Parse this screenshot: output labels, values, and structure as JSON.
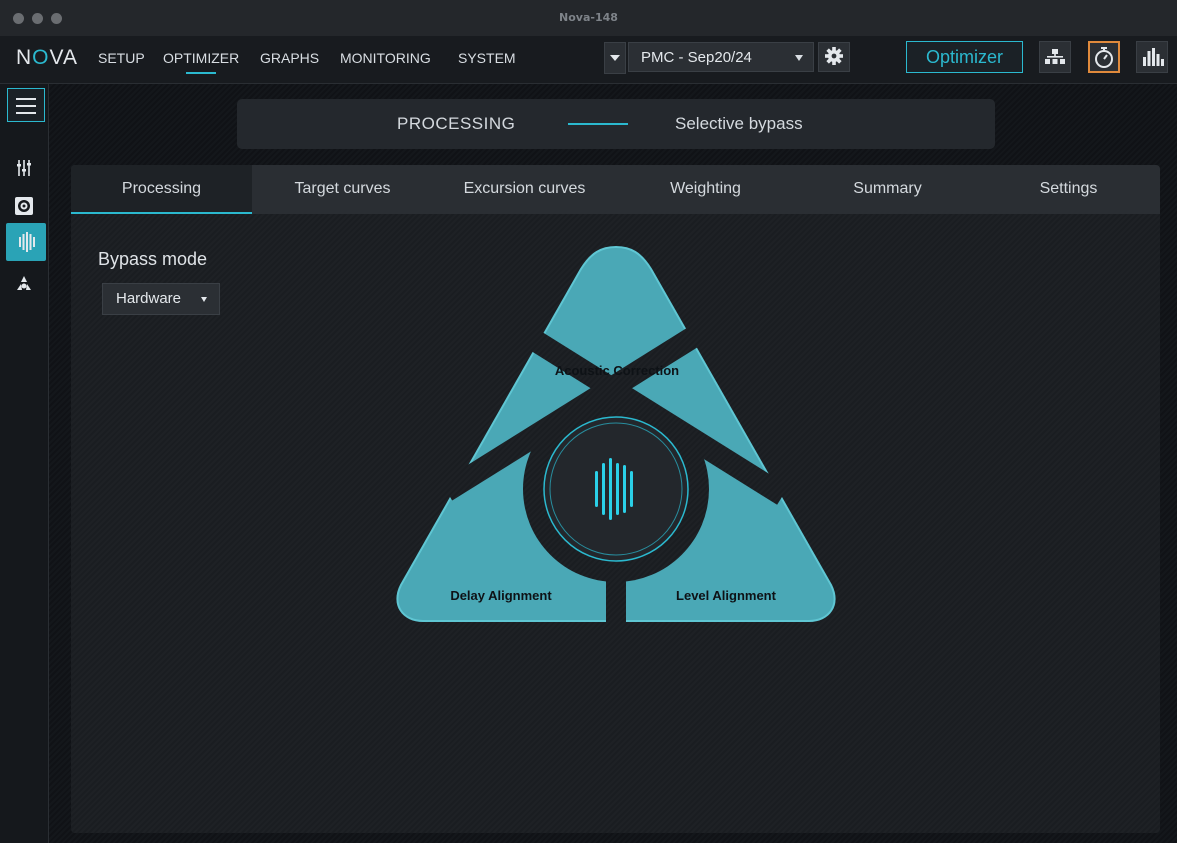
{
  "window": {
    "title": "Nova-148"
  },
  "app": {
    "logo_left": "N",
    "logo_o": "O",
    "logo_right": "VA"
  },
  "nav": [
    {
      "label": "SETUP",
      "active": false
    },
    {
      "label": "OPTIMIZER",
      "active": true
    },
    {
      "label": "GRAPHS",
      "active": false
    },
    {
      "label": "MONITORING",
      "active": false
    },
    {
      "label": "SYSTEM",
      "active": false
    }
  ],
  "preset": {
    "value": "PMC - Sep20/24"
  },
  "toolbar": {
    "optimizer_label": "Optimizer"
  },
  "section": {
    "left": "PROCESSING",
    "right": "Selective bypass"
  },
  "tabs": [
    {
      "label": "Processing",
      "active": true
    },
    {
      "label": "Target curves",
      "active": false
    },
    {
      "label": "Excursion curves",
      "active": false
    },
    {
      "label": "Weighting",
      "active": false
    },
    {
      "label": "Summary",
      "active": false
    },
    {
      "label": "Settings",
      "active": false
    }
  ],
  "bypass": {
    "label": "Bypass mode",
    "value": "Hardware"
  },
  "diagram": {
    "top": "Acoustic Correction",
    "left": "Delay Alignment",
    "right": "Level Alignment"
  },
  "colors": {
    "accent": "#2bb9cf",
    "segment": "#4aa8b6",
    "highlight": "#e08a3c"
  }
}
